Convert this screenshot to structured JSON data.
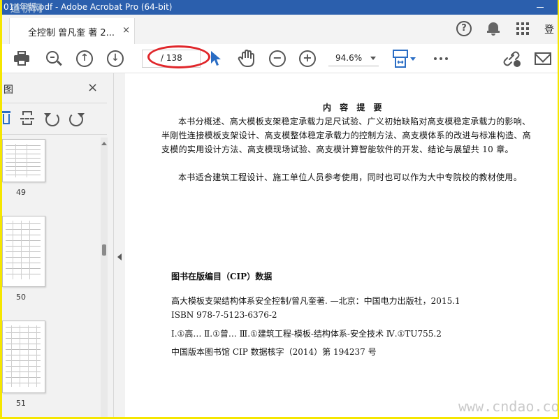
{
  "window": {
    "title": "014年版.pdf - Adobe Acrobat Pro (64-bit)",
    "watermark_top": "道桥网"
  },
  "tabbar": {
    "doc_tab_label": "全控制 曾凡奎 著 2...",
    "doc_tab_close": "×",
    "help_icon": "?",
    "sign_in_text": "登"
  },
  "toolbar": {
    "page_input_value": "",
    "page_total": "/ 138",
    "zoom_out_glyph": "−",
    "zoom_in_glyph": "+",
    "zoom_value": "94.6%",
    "page_up_glyph": "↑",
    "page_down_glyph": "↓"
  },
  "sidebar": {
    "title": "图",
    "close": "×",
    "thumbnails": [
      {
        "label": "49"
      },
      {
        "label": "50"
      },
      {
        "label": "51"
      }
    ]
  },
  "document": {
    "summary_heading": "内 容 提 要",
    "paragraph_1": "本书分概述、高大模板支架稳定承载力足尺试验、广义初始缺陷对高支模稳定承载力的影响、半刚性连接模板支架设计、高支模整体稳定承载力的控制方法、高支模体系的改进与标准构造、高支模的实用设计方法、高支模现场试验、高支模计算智能软件的开发、结论与展望共 10 章。",
    "paragraph_2": "本书适合建筑工程设计、施工单位人员参考使用，同时也可以作为大中专院校的教材使用。",
    "cip_heading": "图书在版编目（CIP）数据",
    "cip_line_1": "高大模板支架结构体系安全控制/曾凡奎著.  —北京：中国电力出版社，2015.1",
    "cip_line_2": "ISBN 978-7-5123-6376-2",
    "cip_line_3": "Ⅰ.①高…   Ⅱ.①曾…   Ⅲ.①建筑工程-模板-结构体系-安全技术   Ⅳ.①TU755.2",
    "cip_line_4": "中国版本图书馆 CIP 数据核字（2014）第 194237 号",
    "watermark_bottom": "www.cndao.com"
  },
  "colors": {
    "titlebar": "#2b5fad",
    "highlight_ellipse": "#e0262a",
    "frame_border": "#f5e600",
    "accent_blue": "#2a6dc4"
  }
}
